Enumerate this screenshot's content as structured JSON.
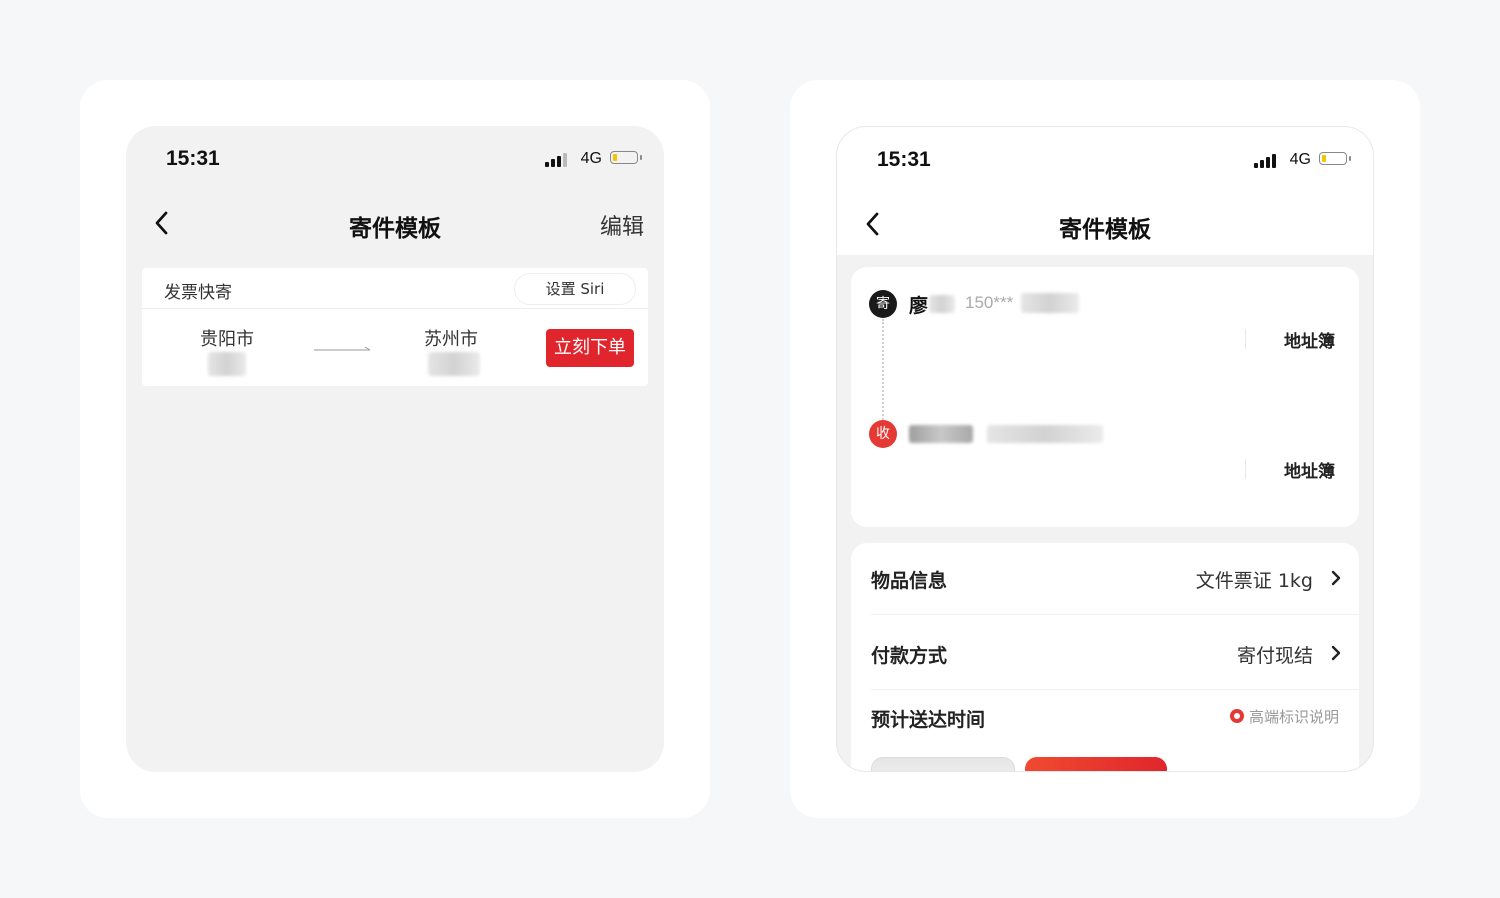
{
  "status_bar": {
    "time": "15:31",
    "network": "4G"
  },
  "left_screen": {
    "nav": {
      "title": "寄件模板",
      "action": "编辑"
    },
    "template": {
      "name": "发票快寄",
      "siri_button": "设置 Siri",
      "from_city": "贵阳市",
      "to_city": "苏州市",
      "order_button": "立刻下单"
    }
  },
  "right_screen": {
    "nav": {
      "title": "寄件模板"
    },
    "sender": {
      "badge": "寄",
      "name": "廖",
      "phone": "150***"
    },
    "receiver": {
      "badge": "收"
    },
    "address_book_label": "地址簿",
    "rows": [
      {
        "label": "物品信息",
        "value": "文件票证 1kg"
      },
      {
        "label": "付款方式",
        "value": "寄付现结"
      },
      {
        "label": "预计送达时间",
        "hint": "高端标识说明"
      }
    ]
  },
  "colors": {
    "accent_red": "#e0262c",
    "badge_sender": "#1a1a1a",
    "badge_receiver": "#e53935",
    "battery": "#f5c400"
  }
}
